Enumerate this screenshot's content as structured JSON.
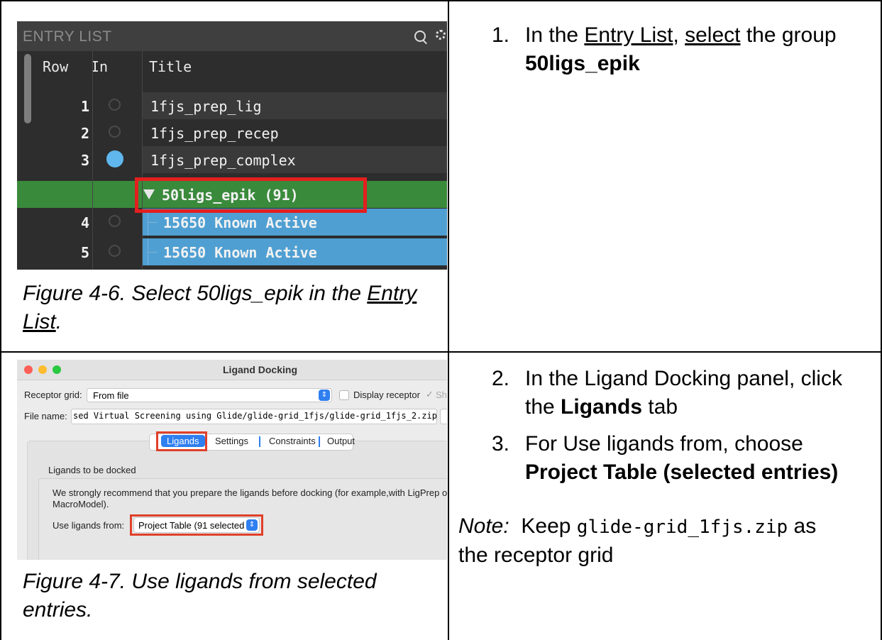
{
  "figure1": {
    "header_title": "ENTRY LIST",
    "columns": {
      "row": "Row",
      "in": "In",
      "title": "Title"
    },
    "rows": [
      {
        "num": "1",
        "title": "1fjs_prep_lig"
      },
      {
        "num": "2",
        "title": "1fjs_prep_recep"
      },
      {
        "num": "3",
        "title": "1fjs_prep_complex"
      },
      {
        "num": "",
        "title": "50ligs_epik (91)"
      },
      {
        "num": "4",
        "title": "15650 Known Active"
      },
      {
        "num": "5",
        "title": "15650 Known Active"
      }
    ],
    "caption_pre": "Figure 4-6. Select 50ligs_epik in the ",
    "caption_link1": "Entry",
    "caption_link2": "List",
    "caption_post": "."
  },
  "step1": {
    "num": "1.",
    "pre": "In the ",
    "link1": "Entry List",
    "mid": ", ",
    "link2": "select",
    "post": " the group",
    "bold": "50ligs_epik"
  },
  "figure2": {
    "window_title": "Ligand Docking",
    "receptor_grid_label": "Receptor grid:",
    "receptor_grid_value": "From file",
    "display_receptor": "Display receptor",
    "show_cut": "Sho",
    "file_name_label": "File name:",
    "file_name_value": "sed Virtual Screening using Glide/glide-grid_1fjs/glide-grid_1fjs_2.zip",
    "tabs": [
      "Ligands",
      "Settings",
      "Constraints",
      "Output"
    ],
    "group_title": "Ligands to be docked",
    "recommend_line1": "We strongly recommend that you prepare the ligands before docking (for example,with LigPrep or",
    "recommend_line2": "MacroModel).",
    "use_ligands_label": "Use ligands from:",
    "use_ligands_value": "Project Table (91 selected",
    "caption_line1": "Figure 4-7. Use ligands from selected",
    "caption_line2": "entries."
  },
  "step2": {
    "num": "2.",
    "line1": "In the Ligand Docking panel, click",
    "pre": "the ",
    "bold": "Ligands",
    "post": " tab"
  },
  "step3": {
    "num": "3.",
    "line1": "For Use ligands from, choose",
    "bold": "Project Table (selected entries)"
  },
  "note": {
    "label": "Note:",
    "pre": "  Keep ",
    "code": "glide-grid_1fjs.zip",
    "post": " as",
    "line2": "the receptor grid"
  },
  "colors": {
    "group_green": "#3a8a3c",
    "selected_blue": "#4f9fd2",
    "highlight_red": "#e31f1f",
    "tab_blue": "#2f7ff0"
  }
}
